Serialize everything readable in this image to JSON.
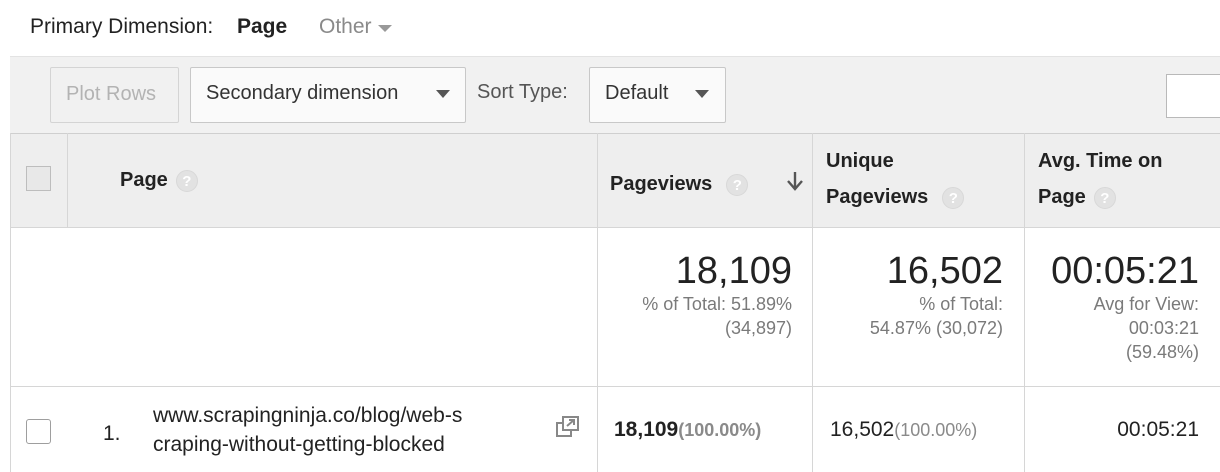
{
  "dimension_bar": {
    "label": "Primary Dimension:",
    "active": "Page",
    "other": "Other"
  },
  "toolbar": {
    "plot_rows": "Plot Rows",
    "secondary_dimension": "Secondary dimension",
    "sort_type_label": "Sort Type:",
    "sort_type_value": "Default"
  },
  "table": {
    "headers": {
      "page": "Page",
      "pageviews": "Pageviews",
      "unique_line1": "Unique",
      "unique_line2": "Pageviews",
      "avg_line1": "Avg. Time on",
      "avg_line2": "Page"
    },
    "help_glyph": "?",
    "totals": {
      "pageviews": "18,109",
      "pageviews_sub1": "% of Total: 51.89%",
      "pageviews_sub2": "(34,897)",
      "unique": "16,502",
      "unique_sub1": "% of Total:",
      "unique_sub2": "54.87% (30,072)",
      "avg": "00:05:21",
      "avg_sub1": "Avg for View:",
      "avg_sub2": "00:03:21",
      "avg_sub3": "(59.48%)"
    },
    "rows": [
      {
        "num": "1.",
        "page_line1": "www.scrapingninja.co/blog/web-s",
        "page_line2": "craping-without-getting-blocked",
        "pageviews": "18,109",
        "pageviews_pct": "(100.00%)",
        "unique": "16,502",
        "unique_pct": "(100.00%)",
        "avg": "00:05:21"
      }
    ]
  }
}
